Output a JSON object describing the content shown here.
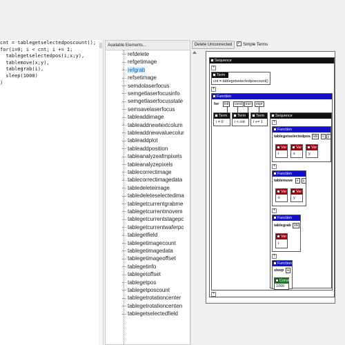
{
  "code": {
    "lines": [
      "cnt = tablegetselectedposcount();",
      "for(i=0; i < cnt; i += 1;",
      "  tablegetselectedpos(i;x;y),",
      "  tablemove(x;y),",
      "  tablegrab(i),",
      "  sleep(1000)",
      ")"
    ]
  },
  "elements": {
    "header": "Available Elements...",
    "items": [
      "refdelete",
      "refgetimage",
      "refgrab",
      "refsetimage",
      "semdolaserfocus",
      "semgetlaserfocusinfo",
      "semgetlaserfocusstate",
      "semsavelaserfocus",
      "tableaddimage",
      "tableaddnewtextcolum",
      "tableaddnewvaluecolur",
      "tableaddplot",
      "tableaddposition",
      "tableanalyzeafmpixels",
      "tableanalyzepixels",
      "tablecorrectimage",
      "tablecorrectimagedata",
      "tabledeleteimage",
      "tabledeleteselectedima",
      "tablegetcurrentgrabme",
      "tablegetcurrentmovem",
      "tablegetcurrentstagepc",
      "tablegetcurrentwaferpc",
      "tablegetfield",
      "tablegetimagecount",
      "tablegetimagedata",
      "tablegetimageoffset",
      "tablegetinfo",
      "tablegetoffset",
      "tablegetpos",
      "tablegetposcount",
      "tablegetrotationcenter",
      "tablegetrotationcenten",
      "tablegetselectedfield"
    ],
    "selected": "refgrab"
  },
  "toolbar": {
    "disconnect_label": "Delete Unconnected",
    "simple_terms_label": "Simple Terms",
    "simple_terms_checked": "✓"
  },
  "canvas": {
    "plus": "+",
    "sequence_outer": "Sequence",
    "term_header": "Term",
    "term_text": "cnt = tablegetselectedposcount()",
    "function_header": "Function",
    "for_label": "for",
    "for_params": [
      "init",
      "cond",
      "incr",
      "expr"
    ],
    "init_text": "i = 0",
    "cond_text": "i < cnt",
    "incr_text": "i += 1",
    "sequence_inner": "Sequence",
    "fn1_name": "tablegetselectedpos",
    "fn1_params": [
      "idx",
      "x",
      "y"
    ],
    "fn1_vars": [
      "i",
      "x",
      "y"
    ],
    "fn2_name": "tablemove",
    "fn2_params": [
      "x",
      "y"
    ],
    "fn2_vars": [
      "x",
      "y"
    ],
    "fn3_name": "tablegrab",
    "fn3_params": [
      "idx"
    ],
    "fn3_vars": [
      "i"
    ],
    "fn4_name": "sleep",
    "fn4_params": [
      "a"
    ],
    "const_header": "Const",
    "const_value": "1000",
    "var_header": "Var"
  }
}
